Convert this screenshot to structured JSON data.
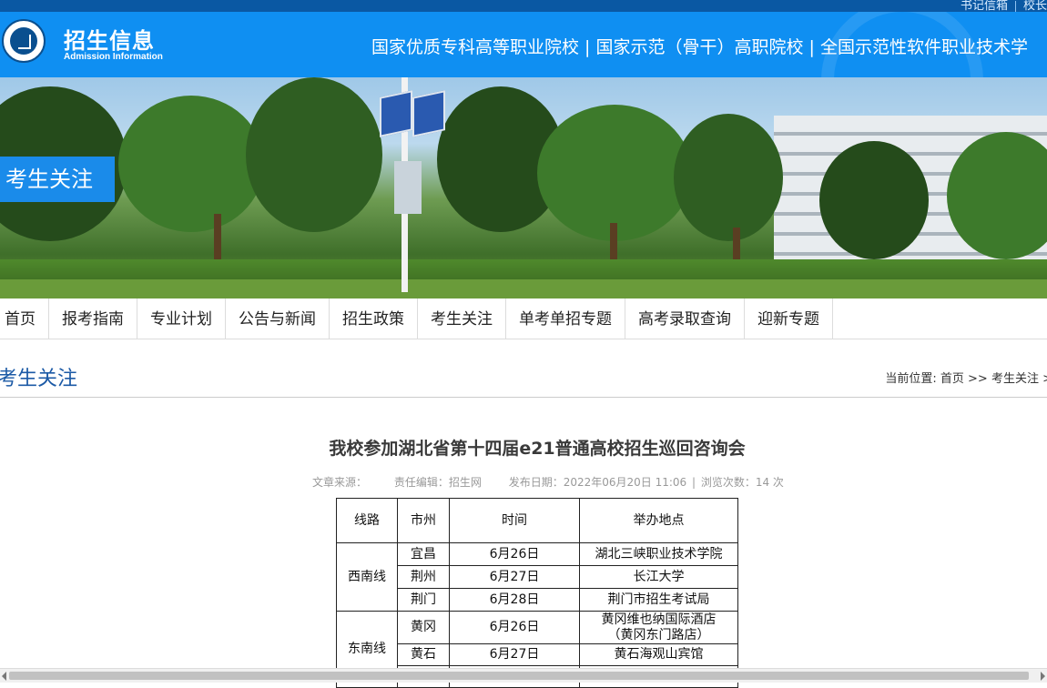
{
  "top_links": [
    "书记信箱",
    "校长"
  ],
  "header": {
    "brand_cn": "招生信息",
    "brand_en": "Admission Information",
    "slogan": "国家优质专科高等职业院校 | 国家示范（骨干）高职院校 | 全国示范性软件职业技术学"
  },
  "banner": {
    "tag": "考生关注"
  },
  "nav": [
    "首页",
    "报考指南",
    "专业计划",
    "公告与新闻",
    "招生政策",
    "考生关注",
    "单考单招专题",
    "高考录取查询",
    "迎新专题"
  ],
  "section": {
    "title": "考生关注",
    "breadcrumb_prefix": "当前位置:",
    "breadcrumb": [
      "首页",
      "考生关注"
    ],
    "breadcrumb_sep": ">>",
    "breadcrumb_tail": ">"
  },
  "article": {
    "title": "我校参加湖北省第十四届e21普通高校招生巡回咨询会",
    "meta": {
      "source_label": "文章来源：",
      "editor": "责任编辑：招生网",
      "date": "发布日期：2022年06月20日 11:06",
      "views": "浏览次数：14 次"
    }
  },
  "table": {
    "headers": [
      "线路",
      "市州",
      "时间",
      "举办地点"
    ],
    "groups": [
      {
        "route": "西南线",
        "rows": [
          {
            "city": "宜昌",
            "date": "6月26日",
            "venue": "湖北三峡职业技术学院"
          },
          {
            "city": "荆州",
            "date": "6月27日",
            "venue": "长江大学"
          },
          {
            "city": "荆门",
            "date": "6月28日",
            "venue": "荆门市招生考试局"
          }
        ]
      },
      {
        "route": "东南线",
        "rows": [
          {
            "city": "黄冈",
            "date": "6月26日",
            "venue": "黄冈维也纳国际酒店",
            "venue2": "（黄冈东门路店）"
          },
          {
            "city": "黄石",
            "date": "6月27日",
            "venue": "黄石海观山宾馆"
          }
        ]
      }
    ]
  },
  "colors": {
    "header_bg": "#0f8ff2",
    "topstrip_bg": "#0a58a3",
    "accent": "#1a8bea",
    "section_title": "#1c5aa6"
  }
}
